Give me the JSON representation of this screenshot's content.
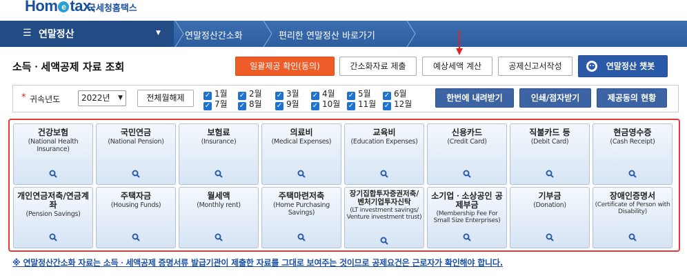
{
  "logo": {
    "text_a": "Hom",
    "text_e": "e",
    "text_b": "tax.",
    "sub": "국세청홈택스"
  },
  "nav": {
    "main_title": "연말정산",
    "crumbs": [
      "연말정산간소화",
      "편리한 연말정산 바로가기"
    ]
  },
  "page_title": "소득ㆍ세액공제 자료 조회",
  "top_buttons": {
    "bulk_consent": "일괄제공 확인(동의)",
    "submit_simple": "간소화자료 제출",
    "estimate_tax": "예상세액 계산",
    "deduction_form": "공제신고서작성",
    "chatbot": "연말정산 챗봇"
  },
  "filter": {
    "required_mark": "*",
    "year_label": "귀속년도",
    "year_value": "2022년",
    "deselect_all": "전체월해제",
    "months": [
      "1월",
      "2월",
      "3월",
      "4월",
      "5월",
      "6월",
      "7월",
      "8월",
      "9월",
      "10월",
      "11월",
      "12월"
    ],
    "download_once": "한번에 내려받기",
    "print_braille": "인쇄/점자받기",
    "provider_status": "제공동의 현황"
  },
  "cards": [
    {
      "ko": "건강보험",
      "en": "(National Health Insurance)"
    },
    {
      "ko": "국민연금",
      "en": "(National Pension)"
    },
    {
      "ko": "보험료",
      "en": "(Insurance)"
    },
    {
      "ko": "의료비",
      "en": "(Medical Expenses)"
    },
    {
      "ko": "교육비",
      "en": "(Education Expenses)"
    },
    {
      "ko": "신용카드",
      "en": "(Credit Card)"
    },
    {
      "ko": "직불카드 등",
      "en": "(Debit Card)"
    },
    {
      "ko": "현금영수증",
      "en": "(Cash Receipt)"
    },
    {
      "ko": "개인연금저축/연금계좌",
      "en": "(Pension Savings)"
    },
    {
      "ko": "주택자금",
      "en": "(Housing Funds)"
    },
    {
      "ko": "월세액",
      "en": "(Monthly rent)"
    },
    {
      "ko": "주택마련저축",
      "en": "(Home Purchasing Savings)"
    },
    {
      "ko": "장기집합투자증권저축/벤처기업투자신탁",
      "en": "(LT investment savings/ Venture investment trust)"
    },
    {
      "ko": "소기업ㆍ소상공인 공제부금",
      "en": "(Membership Fee For Small Size Enterprises)"
    },
    {
      "ko": "기부금",
      "en": "(Donation)"
    },
    {
      "ko": "장애인증명서",
      "en": "(Certificate of Person with Disability)"
    }
  ],
  "notice": "※ 연말정산간소화 자료는 소득ㆍ세액공제 증명서류 발급기관이 제출한 자료를 그대로 보여주는 것이므로 공제요건은 근로자가 확인해야 합니다.",
  "colors": {
    "nav": "#2d5d9e",
    "accent_orange": "#ee5c27",
    "highlight_border": "#e23a3a",
    "link": "#1a4fa8"
  }
}
